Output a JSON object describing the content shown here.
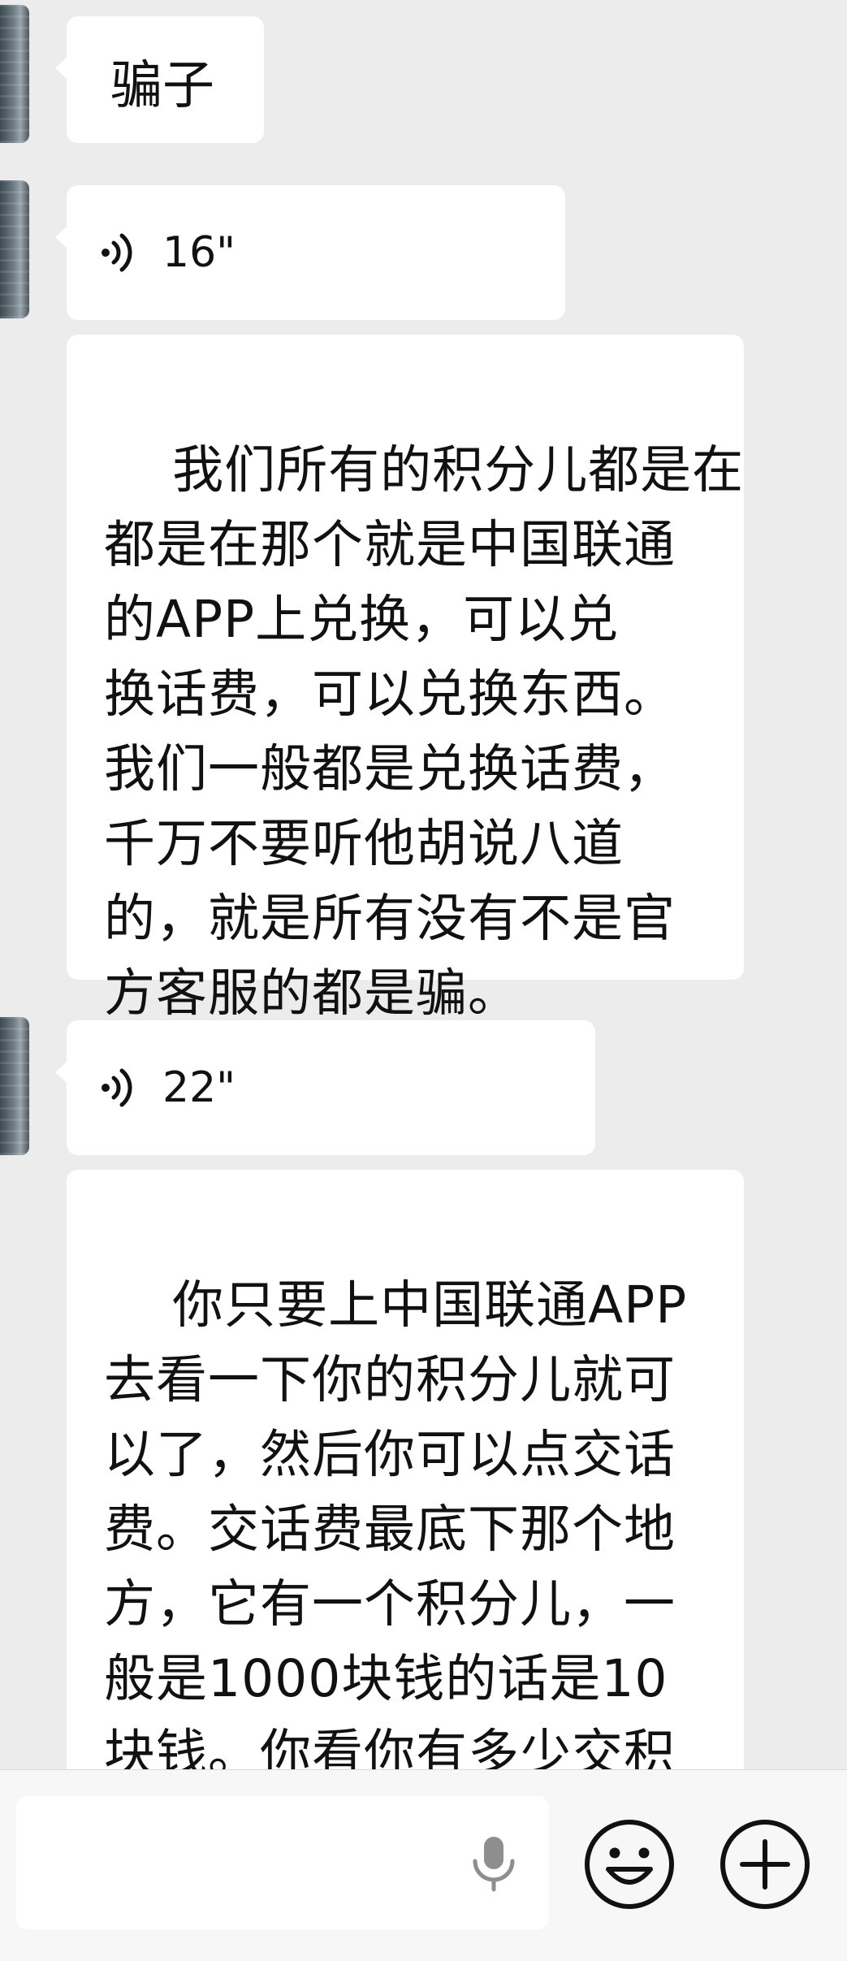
{
  "messages": [
    {
      "type": "text",
      "content": "骗子"
    },
    {
      "type": "voice",
      "duration": "16\""
    },
    {
      "type": "text",
      "content": "我们所有的积分儿都是在\n都是在那个就是中国联通\n的APP上兑换，可以兑\n换话费，可以兑换东西。\n我们一般都是兑换话费，\n千万不要听他胡说八道\n的，就是所有没有不是官\n方客服的都是骗。"
    },
    {
      "type": "voice",
      "duration": "22\""
    },
    {
      "type": "text",
      "content": "你只要上中国联通APP\n去看一下你的积分儿就可\n以了，然后你可以点交话\n费。交话费最底下那个地\n方，它有一个积分儿，一\n般是1000块钱的话是10\n块钱。你看你有多少交积\n分儿，你就交多少话费。"
    }
  ],
  "input_bar": {
    "placeholder": "",
    "icons": [
      "microphone-icon",
      "emoji-icon",
      "plus-icon"
    ]
  },
  "colors": {
    "background": "#ececec",
    "bubble": "#ffffff",
    "text": "#111111"
  }
}
